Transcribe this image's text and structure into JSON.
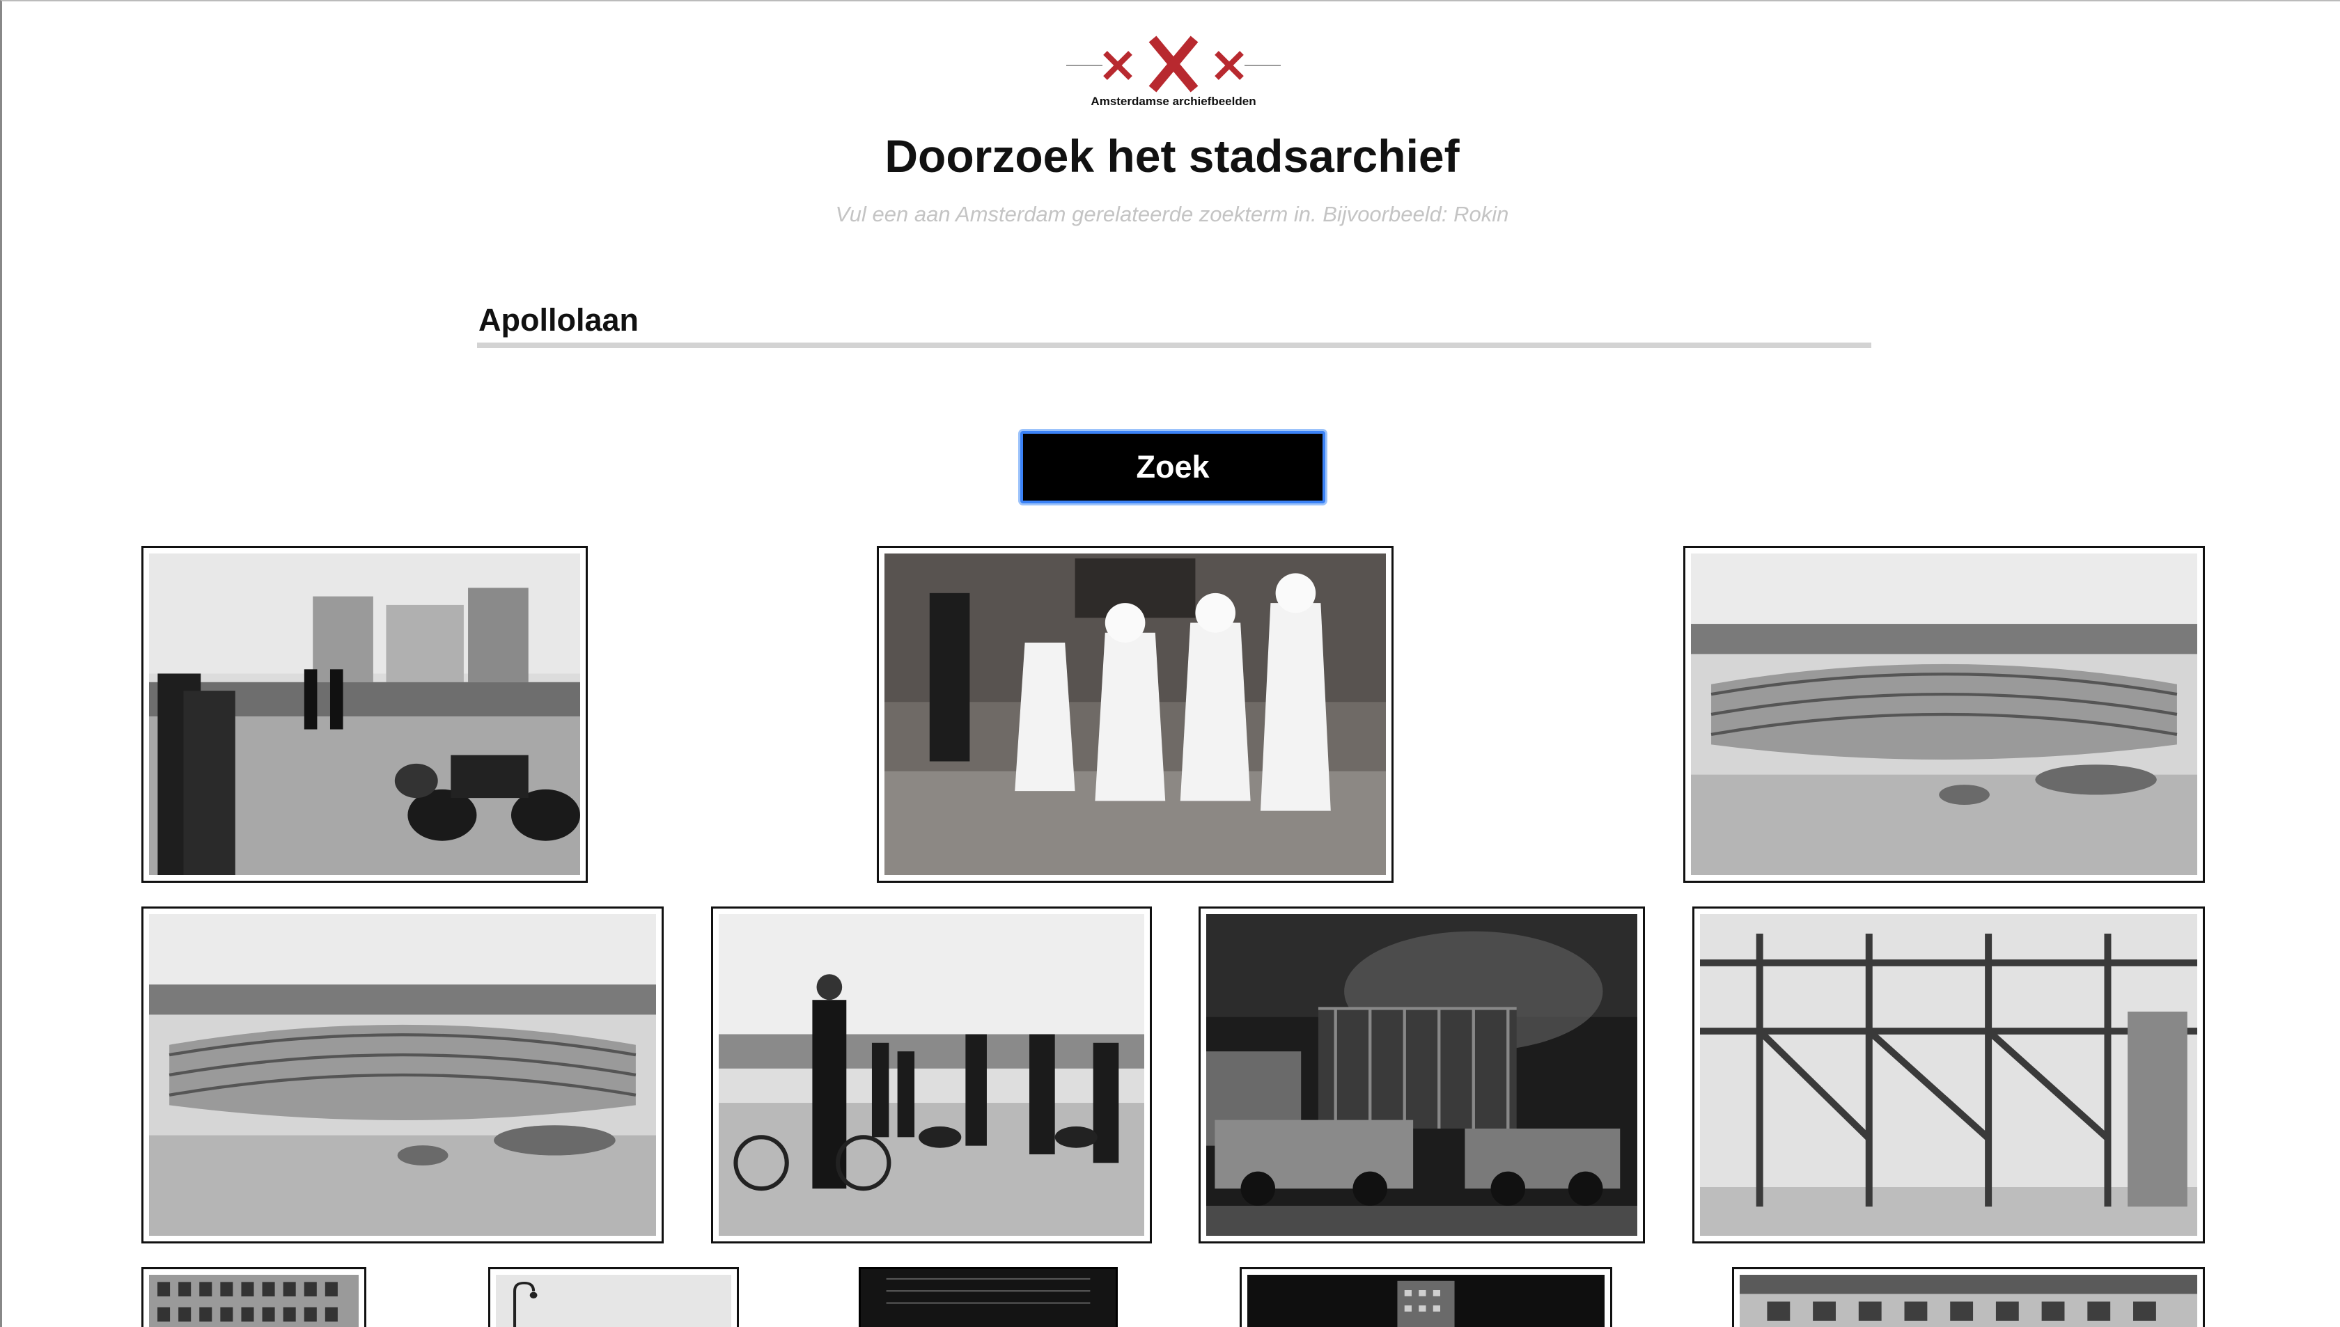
{
  "logo": {
    "text": "Amsterdamse archiefbeelden",
    "accent_color": "#b8292f"
  },
  "header": {
    "title": "Doorzoek het stadsarchief",
    "subtitle": "Vul een aan Amsterdam gerelateerde zoekterm in. Bijvoorbeeld: Rokin"
  },
  "search": {
    "value": "Apollolaan"
  },
  "button": {
    "label": "Zoek",
    "focus_color": "#3b82f6"
  },
  "results": [
    {
      "name": "photo-motorcycle-police-ceremony"
    },
    {
      "name": "photo-women-in-white-raincoats-marching"
    },
    {
      "name": "photo-curved-glass-building-aerial"
    },
    {
      "name": "photo-curved-glass-building-aerial-2"
    },
    {
      "name": "photo-police-with-bicycle-and-dogs"
    },
    {
      "name": "photo-building-fire-with-fire-trucks"
    },
    {
      "name": "photo-steel-frame-construction"
    },
    {
      "name": "photo-apartment-facade"
    },
    {
      "name": "photo-street-lamp"
    },
    {
      "name": "photo-dark-building"
    },
    {
      "name": "photo-tower-night"
    },
    {
      "name": "photo-building-street"
    }
  ]
}
